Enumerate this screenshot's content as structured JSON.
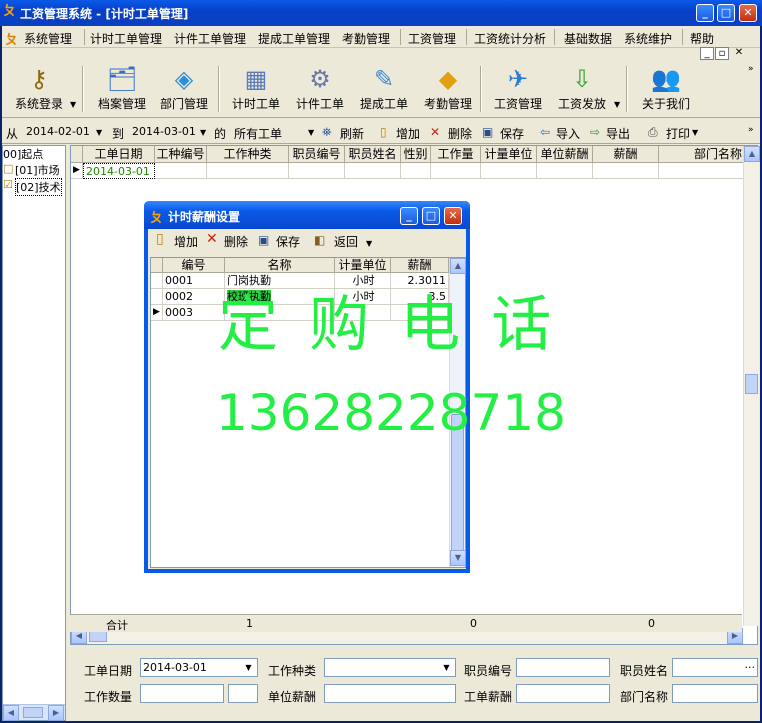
{
  "window": {
    "title": "工资管理系统 - [计时工单管理]"
  },
  "menu": [
    "系统管理",
    "计时工单管理",
    "计件工单管理",
    "提成工单管理",
    "考勤管理",
    "工资管理",
    "工资统计分析",
    "基础数据",
    "系统维护",
    "帮助"
  ],
  "toolbar": [
    {
      "label": "系统登录",
      "icon": "key-icon"
    },
    {
      "label": "档案管理",
      "icon": "folder-icon"
    },
    {
      "label": "部门管理",
      "icon": "department-icon"
    },
    {
      "label": "计时工单",
      "icon": "timesheet-icon"
    },
    {
      "label": "计件工单",
      "icon": "piecework-icon"
    },
    {
      "label": "提成工单",
      "icon": "commission-icon"
    },
    {
      "label": "考勤管理",
      "icon": "attendance-icon"
    },
    {
      "label": "工资管理",
      "icon": "payroll-icon"
    },
    {
      "label": "工资发放",
      "icon": "payout-icon"
    },
    {
      "label": "关于我们",
      "icon": "about-icon"
    }
  ],
  "filter": {
    "from_label": "从",
    "from_date": "2014-02-01",
    "to_label": "到",
    "to_date": "2014-03-01",
    "of_label": "的",
    "scope": "所有工单",
    "refresh": "刷新",
    "add": "增加",
    "delete": "删除",
    "save": "保存",
    "import": "导入",
    "export": "导出",
    "print": "打印"
  },
  "tree": {
    "root": "00]起点",
    "items": [
      "[01]市场",
      "[02]技术"
    ]
  },
  "grid": {
    "columns": [
      "工单日期",
      "工种编号",
      "工作种类",
      "职员编号",
      "职员姓名",
      "性别",
      "工作量",
      "计量单位",
      "单位薪酬",
      "薪酬",
      "部门名称"
    ],
    "rows": [
      {
        "date": "2014-03-01"
      }
    ]
  },
  "summary": {
    "label": "合计",
    "count": "1",
    "workload": "0",
    "salary": "0"
  },
  "form": {
    "date_label": "工单日期",
    "date_value": "2014-03-01",
    "type_label": "工作种类",
    "type_value": "",
    "emp_no_label": "职员编号",
    "emp_name_label": "职员姓名",
    "qty_label": "工作数量",
    "unit_pay_label": "单位薪酬",
    "pay_label": "工单薪酬",
    "dept_label": "部门名称"
  },
  "dialog": {
    "title": "计时薪酬设置",
    "toolbar": {
      "add": "增加",
      "delete": "删除",
      "save": "保存",
      "back": "返回"
    },
    "columns": [
      "编号",
      "名称",
      "计量单位",
      "薪酬"
    ],
    "rows": [
      {
        "no": "0001",
        "name": "门岗执勤",
        "unit": "小时",
        "pay": "2.3011"
      },
      {
        "no": "0002",
        "name": "校班执勤",
        "unit": "小时",
        "pay": "3.5"
      },
      {
        "no": "0003",
        "name": "",
        "unit": "",
        "pay": ""
      }
    ]
  },
  "watermark": {
    "line1": "定 购 电 话",
    "line2": "13628228718"
  }
}
